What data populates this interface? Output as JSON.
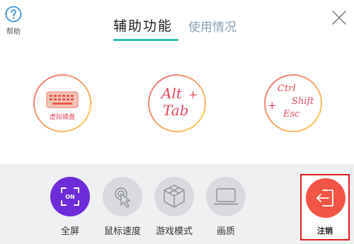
{
  "header": {
    "help_label": "帮助",
    "tabs": [
      {
        "label": "辅助功能",
        "active": true
      },
      {
        "label": "使用情况",
        "active": false
      }
    ],
    "accent_color": "#2bbfae"
  },
  "shortcuts": {
    "keyboard": {
      "label": "虚拟键盘",
      "icon": "keyboard-icon"
    },
    "alt_tab": {
      "key1": "Alt",
      "plus": "+",
      "key2": "Tab"
    },
    "ctrl_shift_esc": {
      "key1": "Ctrl",
      "plus": "+",
      "key2": "Shift",
      "key3": "Esc"
    },
    "accent_color": "#e3475e"
  },
  "toolbar": {
    "items": [
      {
        "label": "全屏",
        "icon": "fullscreen-on-icon",
        "badge": "ON",
        "color": "#6d2bd9"
      },
      {
        "label": "鼠标速度",
        "icon": "mouse-pointer-icon",
        "color": "#d8dadd"
      },
      {
        "label": "游戏模式",
        "icon": "cube-icon",
        "color": "#d8dadd"
      },
      {
        "label": "画质",
        "icon": "monitor-icon",
        "color": "#d8dadd"
      }
    ],
    "logout": {
      "label": "注销",
      "icon": "logout-icon",
      "color": "#f25446"
    }
  }
}
